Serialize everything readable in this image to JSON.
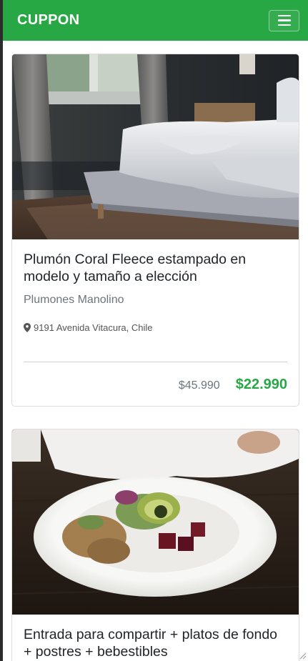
{
  "navbar": {
    "brand": "CUPPON",
    "menu_icon": "hamburger-menu-icon",
    "color": "#28a745"
  },
  "cards": [
    {
      "title": "Plumón Coral Fleece estampado en modelo y tamaño a elección",
      "merchant": "Plumones Manolino",
      "location_icon": "map-marker-icon",
      "location": "9191 Avenida Vitacura, Chile",
      "old_price": "$45.990",
      "new_price": "$22.990",
      "image": "bedroom-photo"
    },
    {
      "title": "Entrada para compartir + platos de fondo + postres + bebestibles",
      "image": "salad-plate-photo"
    }
  ]
}
